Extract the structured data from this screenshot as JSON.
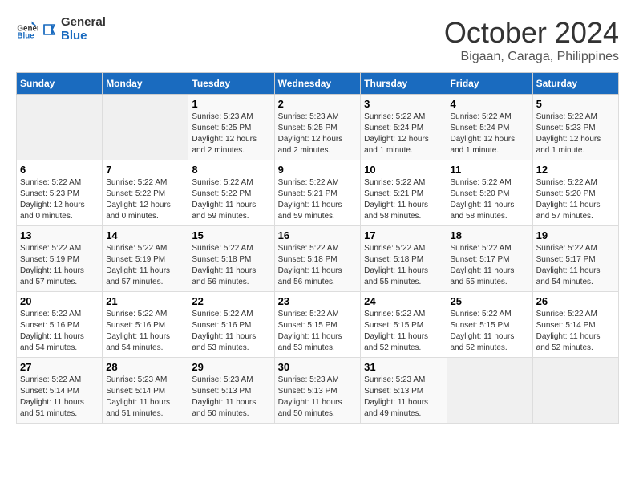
{
  "logo": {
    "line1": "General",
    "line2": "Blue"
  },
  "title": "October 2024",
  "subtitle": "Bigaan, Caraga, Philippines",
  "headers": [
    "Sunday",
    "Monday",
    "Tuesday",
    "Wednesday",
    "Thursday",
    "Friday",
    "Saturday"
  ],
  "weeks": [
    [
      {
        "day": "",
        "info": ""
      },
      {
        "day": "",
        "info": ""
      },
      {
        "day": "1",
        "info": "Sunrise: 5:23 AM\nSunset: 5:25 PM\nDaylight: 12 hours and 2 minutes."
      },
      {
        "day": "2",
        "info": "Sunrise: 5:23 AM\nSunset: 5:25 PM\nDaylight: 12 hours and 2 minutes."
      },
      {
        "day": "3",
        "info": "Sunrise: 5:22 AM\nSunset: 5:24 PM\nDaylight: 12 hours and 1 minute."
      },
      {
        "day": "4",
        "info": "Sunrise: 5:22 AM\nSunset: 5:24 PM\nDaylight: 12 hours and 1 minute."
      },
      {
        "day": "5",
        "info": "Sunrise: 5:22 AM\nSunset: 5:23 PM\nDaylight: 12 hours and 1 minute."
      }
    ],
    [
      {
        "day": "6",
        "info": "Sunrise: 5:22 AM\nSunset: 5:23 PM\nDaylight: 12 hours and 0 minutes."
      },
      {
        "day": "7",
        "info": "Sunrise: 5:22 AM\nSunset: 5:22 PM\nDaylight: 12 hours and 0 minutes."
      },
      {
        "day": "8",
        "info": "Sunrise: 5:22 AM\nSunset: 5:22 PM\nDaylight: 11 hours and 59 minutes."
      },
      {
        "day": "9",
        "info": "Sunrise: 5:22 AM\nSunset: 5:21 PM\nDaylight: 11 hours and 59 minutes."
      },
      {
        "day": "10",
        "info": "Sunrise: 5:22 AM\nSunset: 5:21 PM\nDaylight: 11 hours and 58 minutes."
      },
      {
        "day": "11",
        "info": "Sunrise: 5:22 AM\nSunset: 5:20 PM\nDaylight: 11 hours and 58 minutes."
      },
      {
        "day": "12",
        "info": "Sunrise: 5:22 AM\nSunset: 5:20 PM\nDaylight: 11 hours and 57 minutes."
      }
    ],
    [
      {
        "day": "13",
        "info": "Sunrise: 5:22 AM\nSunset: 5:19 PM\nDaylight: 11 hours and 57 minutes."
      },
      {
        "day": "14",
        "info": "Sunrise: 5:22 AM\nSunset: 5:19 PM\nDaylight: 11 hours and 57 minutes."
      },
      {
        "day": "15",
        "info": "Sunrise: 5:22 AM\nSunset: 5:18 PM\nDaylight: 11 hours and 56 minutes."
      },
      {
        "day": "16",
        "info": "Sunrise: 5:22 AM\nSunset: 5:18 PM\nDaylight: 11 hours and 56 minutes."
      },
      {
        "day": "17",
        "info": "Sunrise: 5:22 AM\nSunset: 5:18 PM\nDaylight: 11 hours and 55 minutes."
      },
      {
        "day": "18",
        "info": "Sunrise: 5:22 AM\nSunset: 5:17 PM\nDaylight: 11 hours and 55 minutes."
      },
      {
        "day": "19",
        "info": "Sunrise: 5:22 AM\nSunset: 5:17 PM\nDaylight: 11 hours and 54 minutes."
      }
    ],
    [
      {
        "day": "20",
        "info": "Sunrise: 5:22 AM\nSunset: 5:16 PM\nDaylight: 11 hours and 54 minutes."
      },
      {
        "day": "21",
        "info": "Sunrise: 5:22 AM\nSunset: 5:16 PM\nDaylight: 11 hours and 54 minutes."
      },
      {
        "day": "22",
        "info": "Sunrise: 5:22 AM\nSunset: 5:16 PM\nDaylight: 11 hours and 53 minutes."
      },
      {
        "day": "23",
        "info": "Sunrise: 5:22 AM\nSunset: 5:15 PM\nDaylight: 11 hours and 53 minutes."
      },
      {
        "day": "24",
        "info": "Sunrise: 5:22 AM\nSunset: 5:15 PM\nDaylight: 11 hours and 52 minutes."
      },
      {
        "day": "25",
        "info": "Sunrise: 5:22 AM\nSunset: 5:15 PM\nDaylight: 11 hours and 52 minutes."
      },
      {
        "day": "26",
        "info": "Sunrise: 5:22 AM\nSunset: 5:14 PM\nDaylight: 11 hours and 52 minutes."
      }
    ],
    [
      {
        "day": "27",
        "info": "Sunrise: 5:22 AM\nSunset: 5:14 PM\nDaylight: 11 hours and 51 minutes."
      },
      {
        "day": "28",
        "info": "Sunrise: 5:23 AM\nSunset: 5:14 PM\nDaylight: 11 hours and 51 minutes."
      },
      {
        "day": "29",
        "info": "Sunrise: 5:23 AM\nSunset: 5:13 PM\nDaylight: 11 hours and 50 minutes."
      },
      {
        "day": "30",
        "info": "Sunrise: 5:23 AM\nSunset: 5:13 PM\nDaylight: 11 hours and 50 minutes."
      },
      {
        "day": "31",
        "info": "Sunrise: 5:23 AM\nSunset: 5:13 PM\nDaylight: 11 hours and 49 minutes."
      },
      {
        "day": "",
        "info": ""
      },
      {
        "day": "",
        "info": ""
      }
    ]
  ]
}
